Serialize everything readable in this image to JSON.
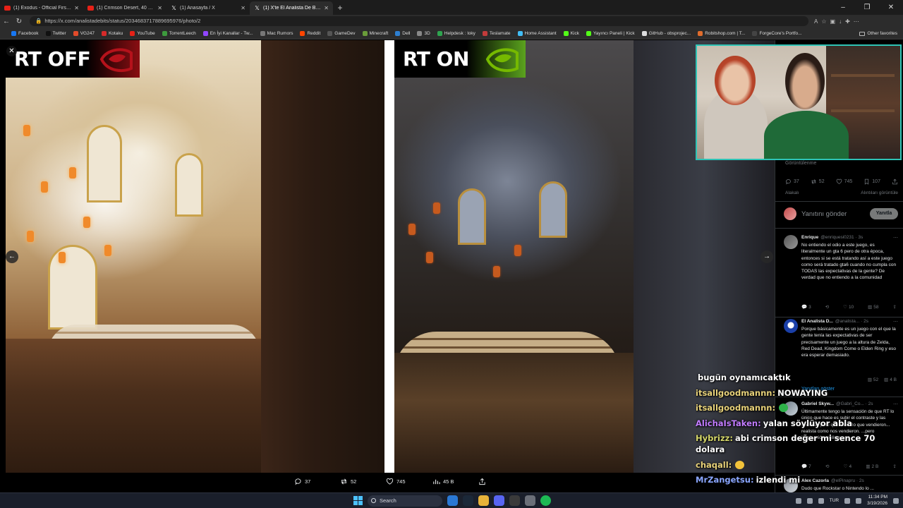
{
  "tabs": [
    {
      "title": "(1) Exodus - Official First Look Gar",
      "icon": "youtube-icon"
    },
    {
      "title": "(1) Crimson Desert, 40 GPU Bench",
      "icon": "youtube-icon"
    },
    {
      "title": "(1) Anasayfa / X",
      "icon": "x-icon"
    },
    {
      "title": "(1) X'te El Analista De Bits: \"El Ray",
      "icon": "x-icon",
      "active": true
    }
  ],
  "url": "https://x.com/analistadebits/status/2034683717889695976/photo/2",
  "bookmarks": [
    "Facebook",
    "Twitter",
    "VG247",
    "Kotaku",
    "YouTube",
    "TorrentLeech",
    "En İyi Kanallar - Tw...",
    "Mac Rumors",
    "Reddit",
    "GameDev",
    "Minecraft",
    "Dell",
    "3D",
    "Helpdesk : loky",
    "Teslamate",
    "Home Assistant",
    "Kick",
    "Yayıncı Paneli | Kick",
    "GitHub - obsprojec...",
    "Robitshop.com | T...",
    "ForgeCore's Portfo..."
  ],
  "bookmarks_other": "Other favorites",
  "viewer": {
    "left_label": "RT OFF",
    "right_label": "RT ON",
    "actions": {
      "replies": "37",
      "reposts": "52",
      "likes": "745",
      "views": "45 B"
    }
  },
  "sidebar": {
    "views_label": "Görüntülenme",
    "stats": {
      "replies": "37",
      "reposts": "52",
      "likes": "745",
      "bookmarks": "107"
    },
    "related_left": "Alakalı",
    "related_right": "Alıntıları görüntüle",
    "reply_placeholder": "Yanıtını gönder",
    "reply_button": "Yanıtla",
    "show_replies": "Yanıtları göster",
    "replies": [
      {
        "name": "Enrique",
        "handle": "@enriquesi0231 · 3s",
        "text": "No entiendo el odio a este juego, es literalmente un gta 6 pero de otra época, entonces si se está tratando así a este juego como será tratado gta6 cuando no cumpla con TODAS las expectativas de la gente? De verdad que no entiendo a la comunidad",
        "stats": [
          "3",
          "",
          "10",
          "58",
          ""
        ]
      },
      {
        "name": "El Analista D...",
        "handle": "@analista... · 2s",
        "text": "Porque básicamente es un juego con el que la gente tenía las expectativas de ser precisamente un juego a la altura de Zelda, Red Dead, Kingdom Come o Elden Ring y eso era esperar demasiado.",
        "stats": [
          "",
          "",
          "",
          "52",
          "4 B"
        ]
      },
      {
        "name": "Gabriel Skyw...",
        "handle": "@Gabri_Co... · 2s",
        "text": "Últimamente tengo la sensación de que RT lo único que hace es subir el contraste y las sombras pero que no es lo que vendieron... realista como nos vendieron. ...pero iluminación realista no.",
        "stats": [
          "7",
          "",
          "4",
          "2 B",
          ""
        ]
      },
      {
        "name": "Alex Cazorla",
        "handle": "@elPinapru · 2s",
        "text": "Dudo que Rockstar o Nintendo lo ...",
        "stats": []
      }
    ]
  },
  "chat": [
    {
      "user": "",
      "user_color": "#ffffff",
      "text": "bugün oynamıcaktık"
    },
    {
      "user": "itsallgoodmannn:",
      "user_color": "#e8d27a",
      "text": "NOWAYING"
    },
    {
      "user": "itsallgoodmannn:",
      "user_color": "#e8d27a",
      "text": ""
    },
    {
      "user": "AlichaIsTaken:",
      "user_color": "#c27cff",
      "text": "yalan söylüyor abla"
    },
    {
      "user": "Hybrizz:",
      "user_color": "#d6d86a",
      "text": "abi crimson değer mi sence 70 dolara"
    },
    {
      "user": "chaqall:",
      "user_color": "#e8d27a",
      "text": ""
    },
    {
      "user": "MrZangetsu:",
      "user_color": "#8aa6ff",
      "text": "izlendi mi"
    }
  ],
  "taskbar": {
    "search_placeholder": "Search",
    "lang": "TUR",
    "time": "11:34 PM",
    "date": "3/19/2026"
  },
  "colors": {
    "x_blue": "#1d9bf0",
    "nvidia_green": "#76b900",
    "nvidia_red": "#b5121b",
    "webcam_border": "#2ec4b6"
  }
}
